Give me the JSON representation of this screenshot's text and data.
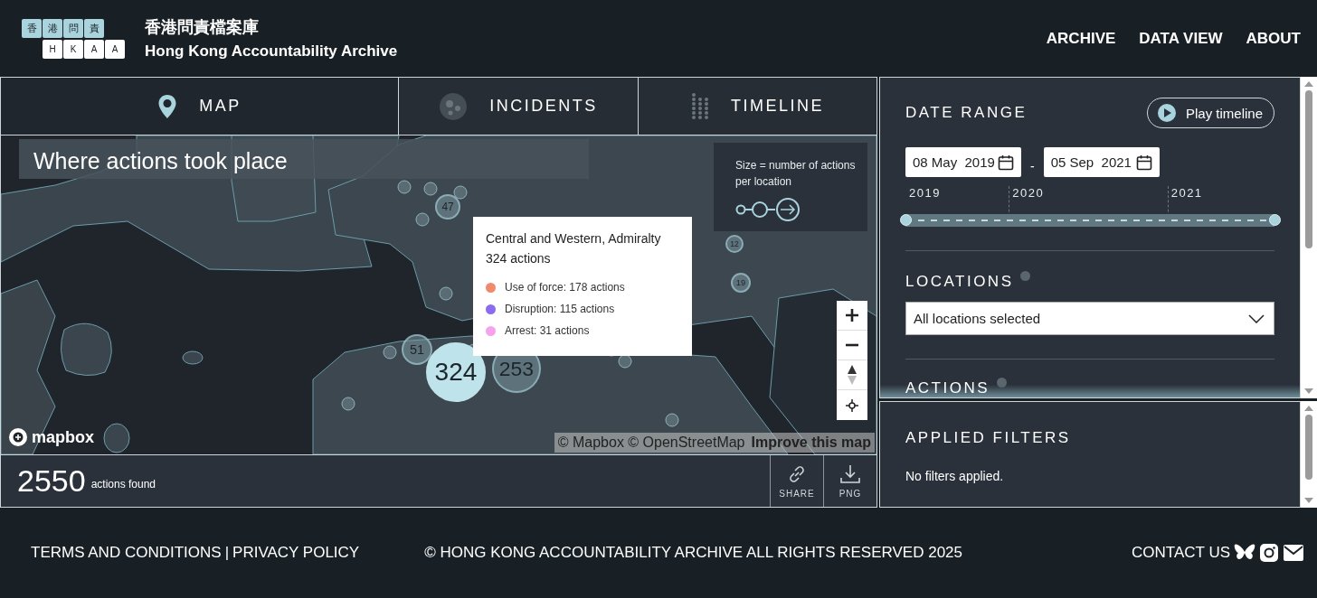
{
  "header": {
    "logo_tiles": {
      "top": [
        "香",
        "港",
        "問",
        "責"
      ],
      "bottom": [
        "H",
        "K",
        "A",
        "A"
      ]
    },
    "title_zh": "香港問責檔案庫",
    "title_en": "Hong Kong Accountability Archive",
    "nav": [
      "ARCHIVE",
      "DATA VIEW",
      "ABOUT"
    ]
  },
  "view_tabs": [
    {
      "label": "MAP",
      "kind": "pin",
      "selected": true
    },
    {
      "label": "INCIDENTS",
      "kind": "dots",
      "selected": false
    },
    {
      "label": "TIMELINE",
      "kind": "grid",
      "selected": false
    }
  ],
  "map": {
    "title": "Where actions took place",
    "legend": "Size =  number of actions per location",
    "clusters": [
      {
        "count": "324",
        "selected": true
      },
      {
        "count": "253",
        "selected": false
      },
      {
        "count": "51",
        "selected": false
      },
      {
        "count": "47",
        "selected": false
      },
      {
        "count": "19",
        "selected": false
      },
      {
        "count": "12",
        "selected": false
      }
    ],
    "tooltip": {
      "title": "Central and Western, Admiralty",
      "total": "324 actions",
      "breakdown": [
        {
          "label": "Use of force: 178 actions",
          "color": "#f08a6e"
        },
        {
          "label": "Disruption: 115 actions",
          "color": "#8b6cf0"
        },
        {
          "label": "Arrest: 31 actions",
          "color": "#f5a3ee"
        }
      ]
    },
    "logo": "mapbox",
    "attribution": "© Mapbox © OpenStreetMap",
    "improve_link": "Improve this map"
  },
  "results": {
    "count": "2550",
    "label": "actions found",
    "buttons": [
      {
        "label": "SHARE",
        "kind": "link"
      },
      {
        "label": "PNG",
        "kind": "download"
      }
    ]
  },
  "filters": {
    "date_range": {
      "heading": "DATE RANGE",
      "play_button": "Play timeline",
      "start": "08 May  2019",
      "separator": "-",
      "end": "05 Sep  2021",
      "years": [
        "2019",
        "2020",
        "2021"
      ],
      "level": 1
    },
    "locations": {
      "heading": "LOCATIONS",
      "value": "All locations selected"
    },
    "actions": {
      "heading": "ACTIONS"
    }
  },
  "applied_filters": {
    "heading": "APPLIED FILTERS",
    "text": "No filters applied."
  },
  "footer": {
    "links": [
      "TERMS AND CONDITIONS",
      "PRIVACY POLICY"
    ],
    "separator": "|",
    "copyright": "© HONG KONG ACCOUNTABILITY ARCHIVE ALL RIGHTS RESERVED 2025",
    "contact": "CONTACT US"
  }
}
